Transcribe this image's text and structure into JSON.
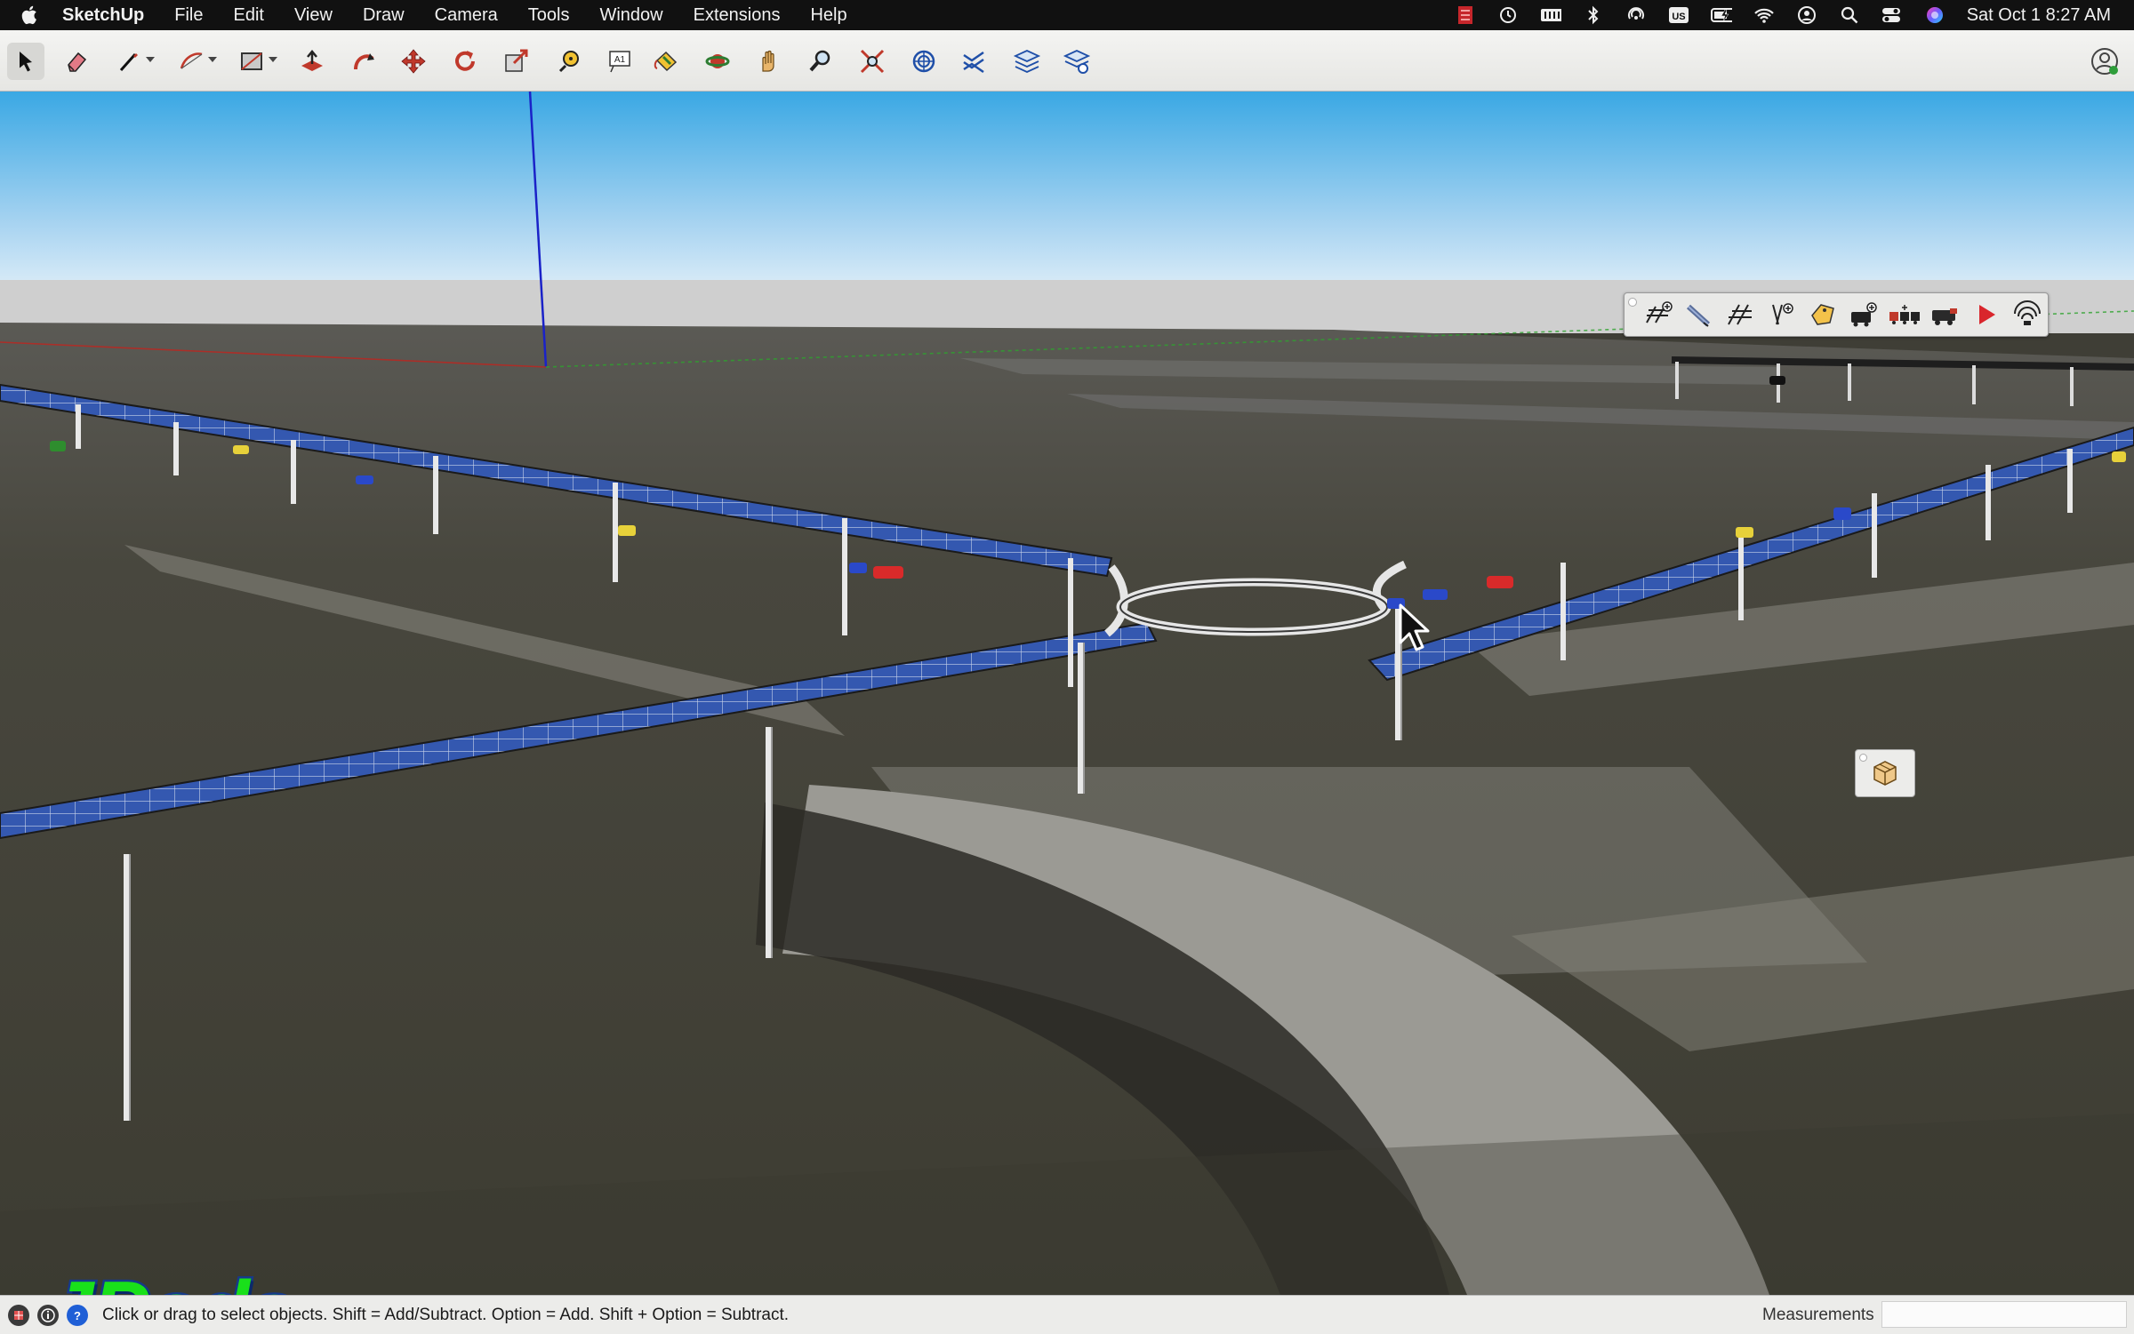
{
  "menubar": {
    "app_name": "SketchUp",
    "items": [
      "File",
      "Edit",
      "View",
      "Draw",
      "Camera",
      "Tools",
      "Window",
      "Extensions",
      "Help"
    ],
    "input_source": "US",
    "datetime": "Sat Oct 1  8:27 AM"
  },
  "toolbar": {
    "tools": [
      "select",
      "eraser",
      "line",
      "arc",
      "rectangle",
      "push-pull",
      "follow-me",
      "move",
      "rotate",
      "scale",
      "tape-measure",
      "text",
      "paint-bucket",
      "orbit",
      "pan",
      "zoom",
      "zoom-extents",
      "add-location",
      "section-plane",
      "layers",
      "layers-settings",
      "layers-manager"
    ],
    "active_tool": "select"
  },
  "jpods_toolbar": {
    "tools": [
      "add-track",
      "draw-track",
      "track-grid",
      "add-pole",
      "tag",
      "add-pod",
      "pod-train",
      "engine",
      "play",
      "broadcast"
    ]
  },
  "logo_text": "JPods",
  "statusbar": {
    "hint": "Click or drag to select objects. Shift = Add/Subtract. Option = Add. Shift + Option = Subtract.",
    "measurements_label": "Measurements",
    "measurements_value": ""
  },
  "colors": {
    "sky_top": "#38a6e2",
    "sky_bottom": "#d4e9f6",
    "logo_green": "#19e01a",
    "logo_outline": "#163a8a",
    "solar_panel": "#2a4fa8",
    "play_red": "#d9262c"
  }
}
